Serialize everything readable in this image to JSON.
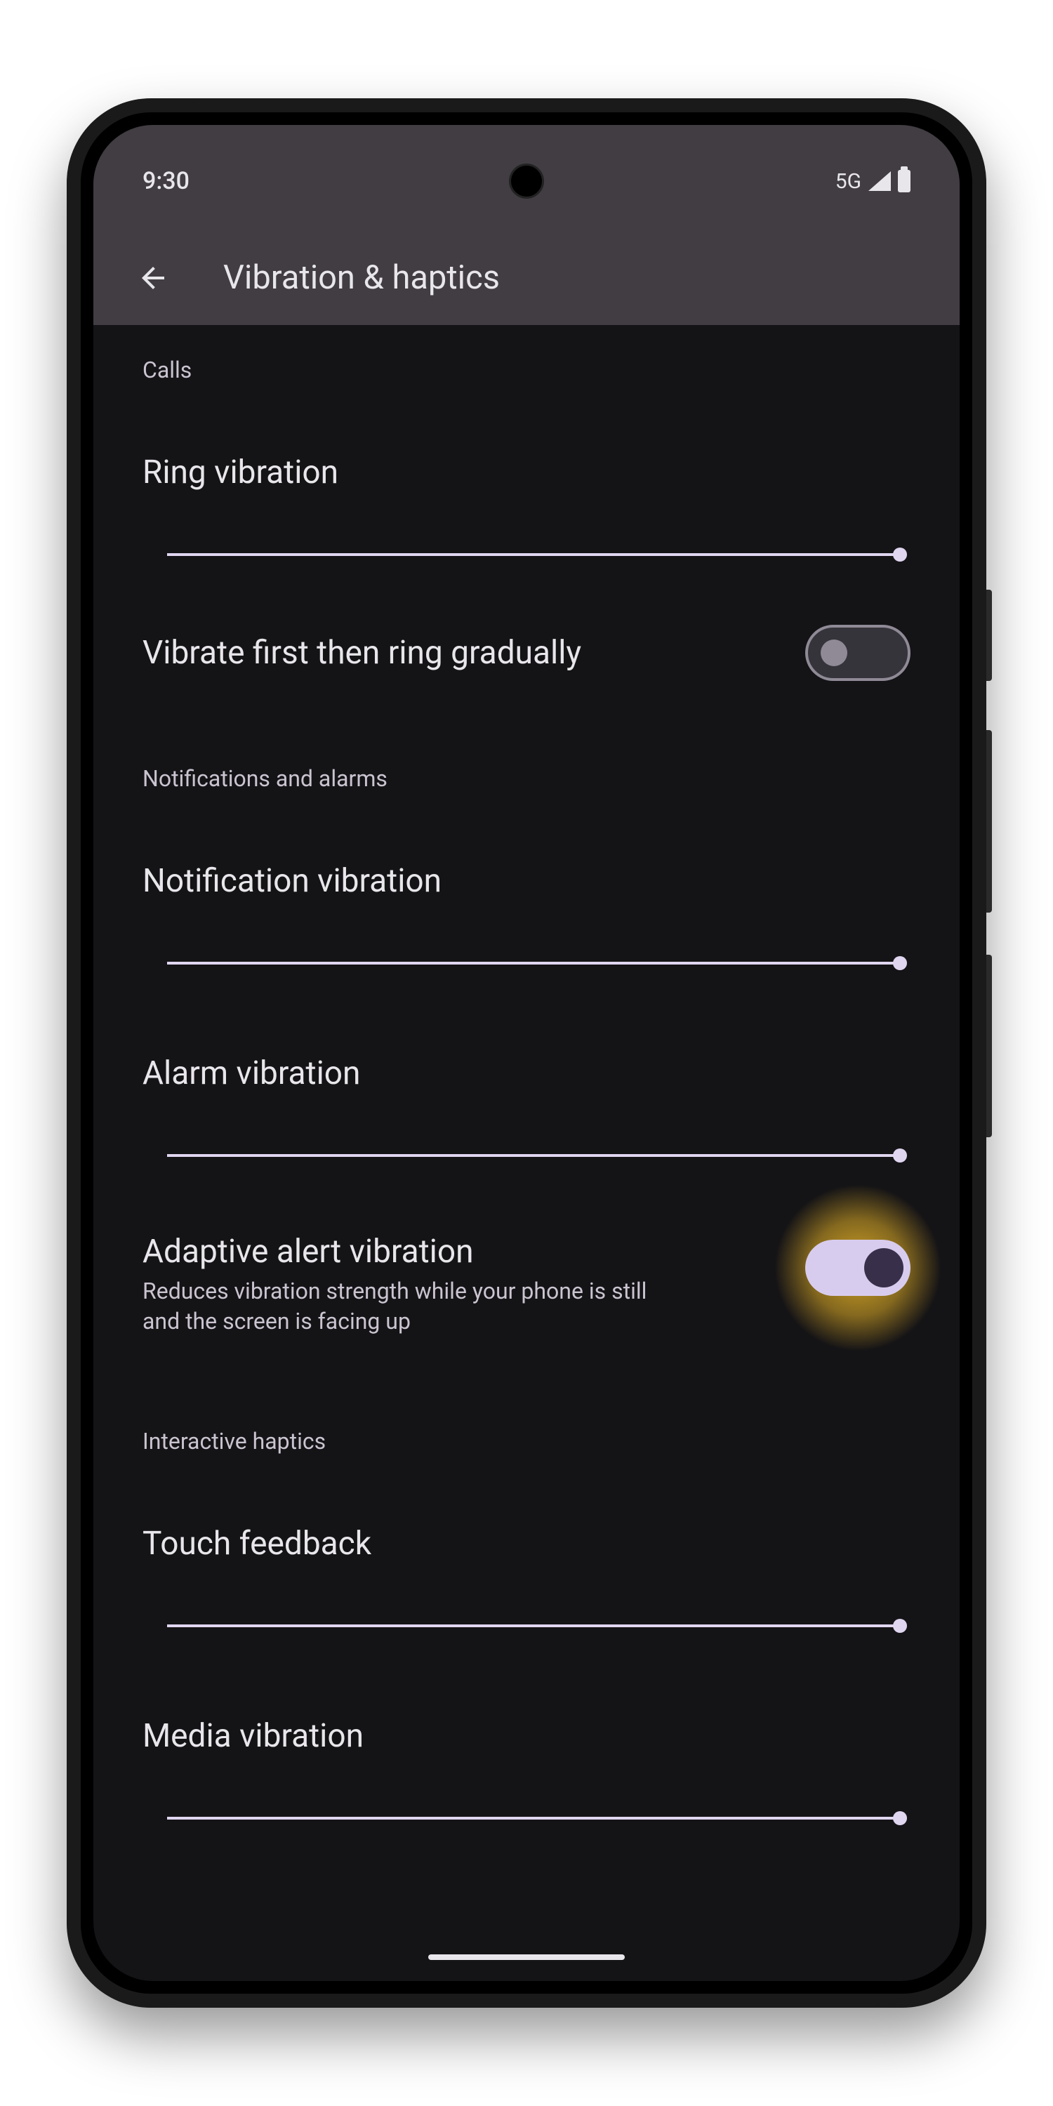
{
  "status": {
    "time": "9:30",
    "network": "5G"
  },
  "header": {
    "title": "Vibration & haptics"
  },
  "sections": {
    "calls": {
      "header": "Calls",
      "ring_vibration": "Ring vibration",
      "vibrate_first": "Vibrate first then ring gradually"
    },
    "notifications": {
      "header": "Notifications and alarms",
      "notification_vibration": "Notification vibration",
      "alarm_vibration": "Alarm vibration",
      "adaptive": {
        "title": "Adaptive alert vibration",
        "subtitle": "Reduces vibration strength while your phone is still and the screen is facing up"
      }
    },
    "interactive": {
      "header": "Interactive haptics",
      "touch_feedback": "Touch feedback",
      "media_vibration": "Media vibration"
    }
  },
  "slider_values": {
    "ring_vibration": 100,
    "notification_vibration": 100,
    "alarm_vibration": 100,
    "touch_feedback": 100,
    "media_vibration": 100
  },
  "toggles": {
    "vibrate_first": false,
    "adaptive_alert": true
  }
}
